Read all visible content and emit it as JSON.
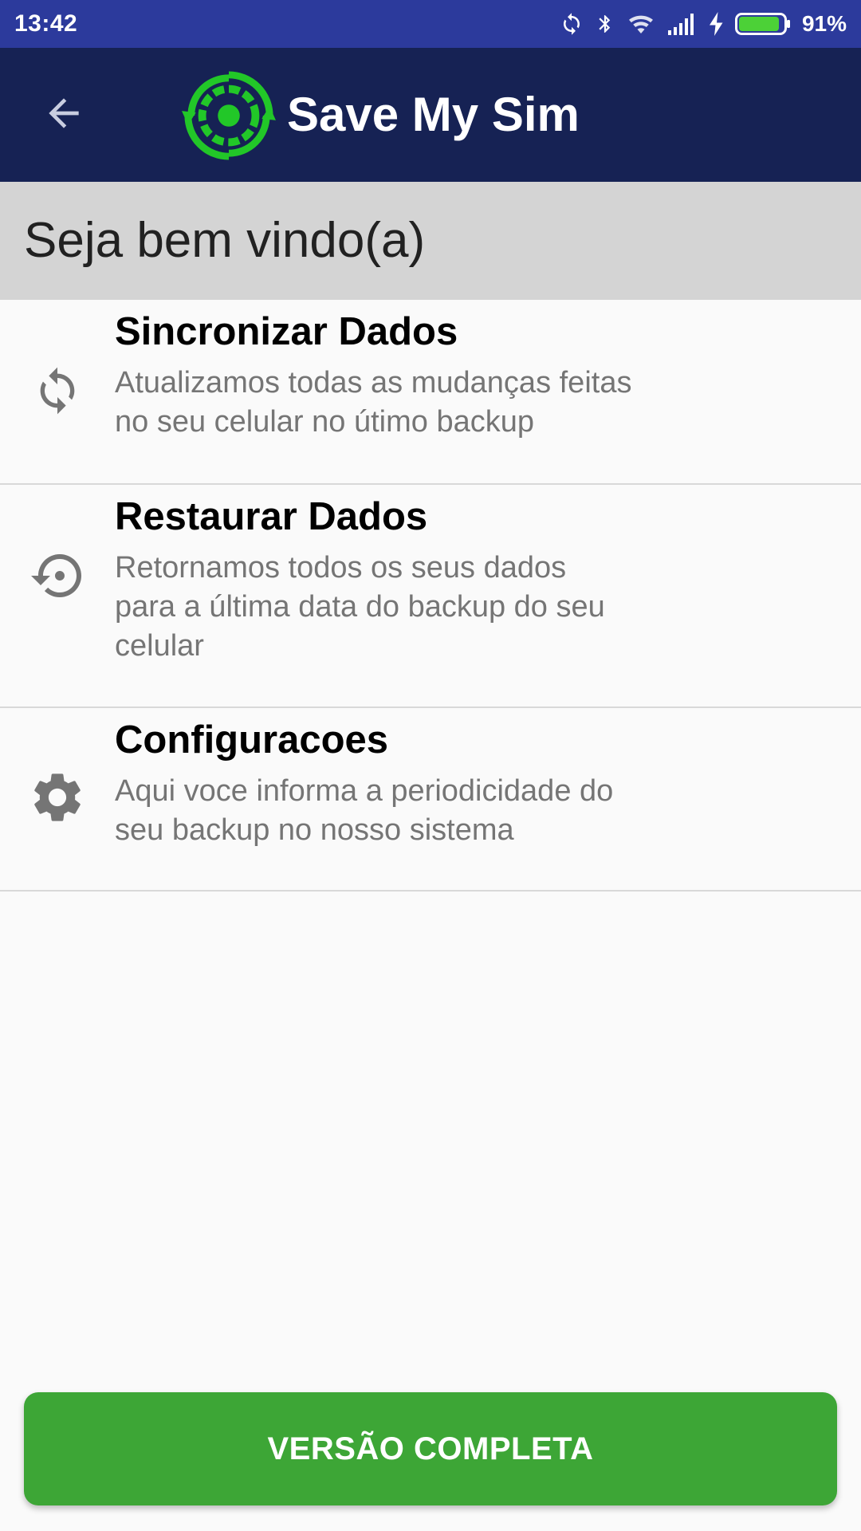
{
  "status_bar": {
    "time": "13:42",
    "battery_percent": "91%",
    "battery_level": 0.91,
    "battery_color": "#4cd137",
    "icons": [
      "sync-icon",
      "bluetooth-icon",
      "wifi-icon",
      "signal-icon",
      "charging-icon",
      "battery-icon"
    ]
  },
  "toolbar": {
    "title": "Save My Sim",
    "back_icon": "arrow-left-icon",
    "logo_icon": "app-logo-icon",
    "background": "#162254",
    "logo_color": "#22c728"
  },
  "welcome": {
    "text": "Seja bem vindo(a)"
  },
  "menu": {
    "items": [
      {
        "icon": "sync-icon",
        "title": "Sincronizar Dados",
        "description": "Atualizamos todas as mudanças feitas no seu celular no útimo backup"
      },
      {
        "icon": "restore-icon",
        "title": "Restaurar Dados",
        "description": "Retornamos todos os seus dados para a última data do backup do seu celular"
      },
      {
        "icon": "gear-icon",
        "title": "Configuracoes",
        "description": "Aqui voce informa a periodicidade do seu backup no nosso sistema"
      }
    ]
  },
  "footer": {
    "button_label": "VERSÃO COMPLETA",
    "button_color": "#3da636"
  }
}
